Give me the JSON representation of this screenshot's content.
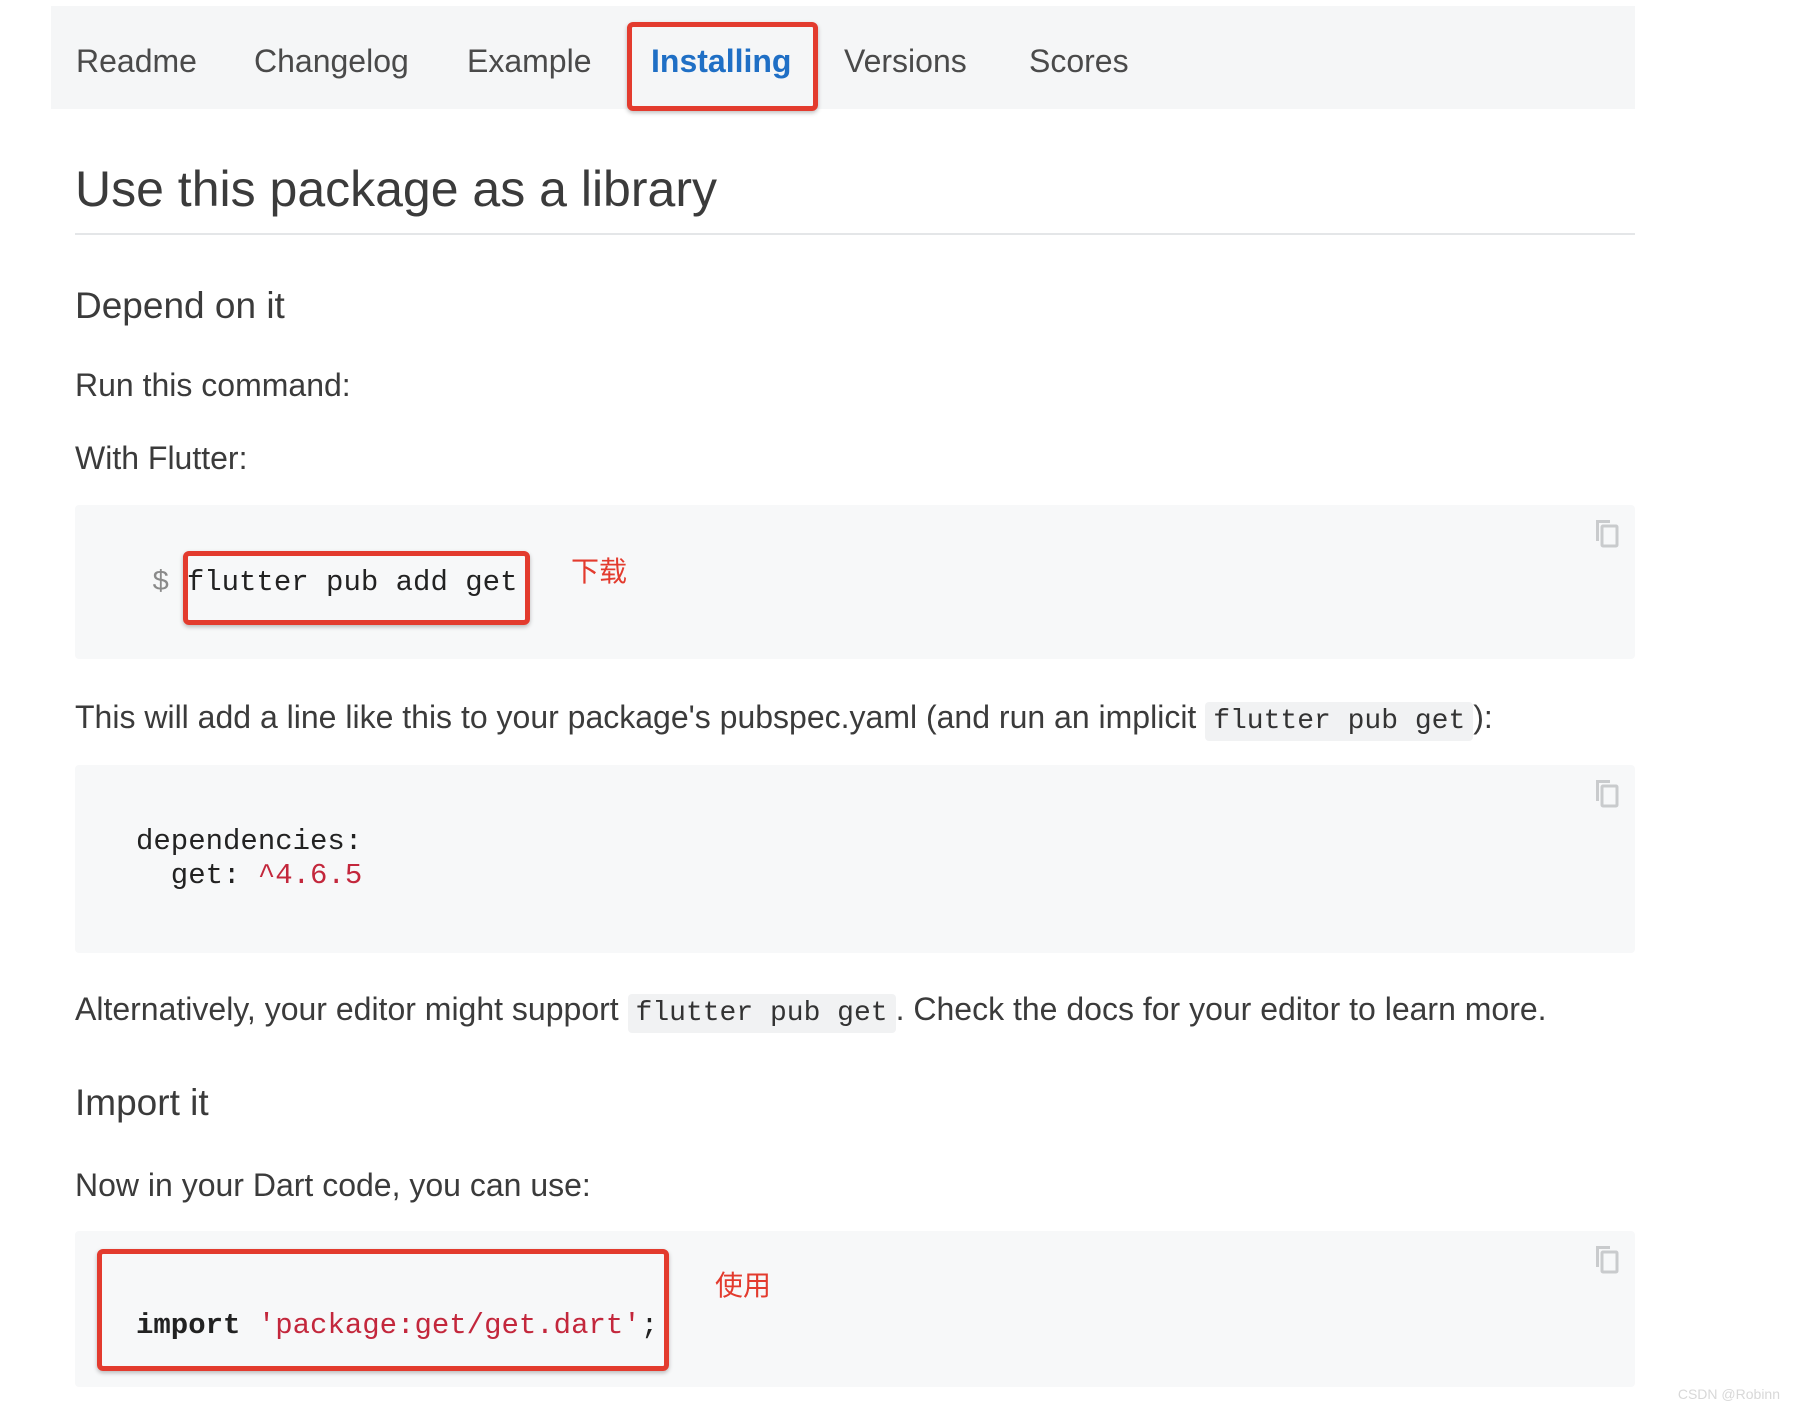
{
  "tabs": {
    "readme": "Readme",
    "changelog": "Changelog",
    "example": "Example",
    "installing": "Installing",
    "versions": "Versions",
    "scores": "Scores",
    "active": "Installing"
  },
  "page_title": "Use this package as a library",
  "depend": {
    "heading": "Depend on it",
    "run_command": "Run this command:",
    "with_flutter": "With Flutter:",
    "prompt": "$",
    "command": "flutter pub add get",
    "note": "下载",
    "explain_before": "This will add a line like this to your package's pubspec.yaml (and run an implicit",
    "explain_code": "flutter pub get",
    "explain_after": "):",
    "yaml_key": "dependencies:",
    "yaml_pkg": "  get: ",
    "yaml_version": "^4.6.5",
    "alt_before": "Alternatively, your editor might support",
    "alt_code": "flutter pub get",
    "alt_after": ". Check the docs for your editor to learn more."
  },
  "import": {
    "heading": "Import it",
    "intro": "Now in your Dart code, you can use:",
    "keyword": "import",
    "path": "'package:get/get.dart'",
    "semicolon": ";",
    "note": "使用"
  },
  "icons": {
    "copy": "copy-icon"
  },
  "colors": {
    "accent": "#1f6fc5",
    "annotation": "#e33b2e",
    "string": "#c3273c"
  },
  "watermark": "CSDN @Robinn"
}
